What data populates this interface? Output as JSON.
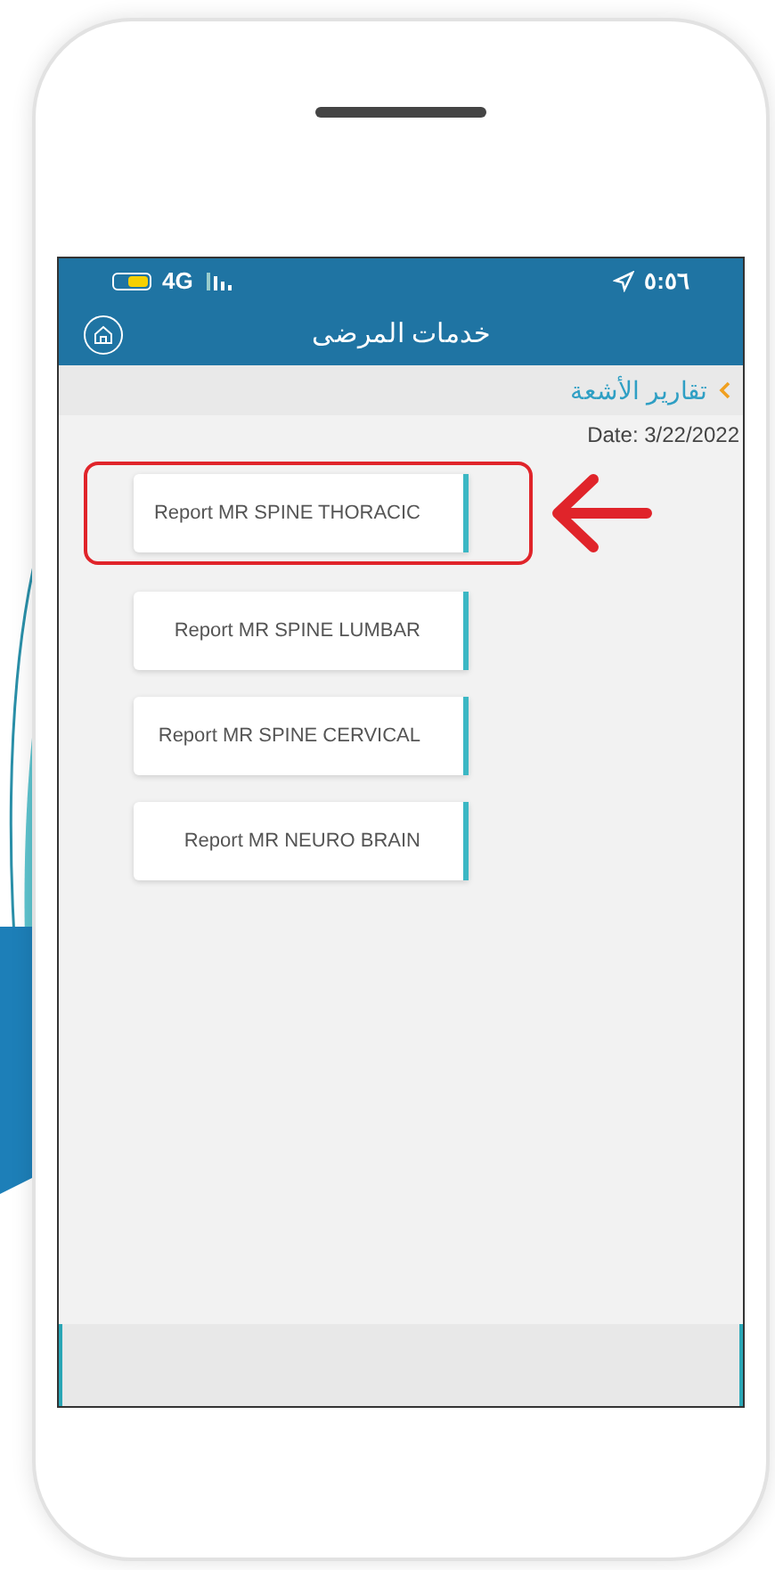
{
  "status_bar": {
    "network": "4G",
    "time": "٥:٥٦"
  },
  "header": {
    "title": "خدمات المرضى"
  },
  "breadcrumb": {
    "label": "تقارير الأشعة"
  },
  "date": "Date: 3/22/2022",
  "reports": [
    {
      "label": "Report MR SPINE THORACIC",
      "highlighted": true
    },
    {
      "label": "Report MR SPINE LUMBAR",
      "highlighted": false
    },
    {
      "label": "Report MR SPINE CERVICAL",
      "highlighted": false
    },
    {
      "label": "Report MR NEURO BRAIN",
      "highlighted": false
    }
  ]
}
